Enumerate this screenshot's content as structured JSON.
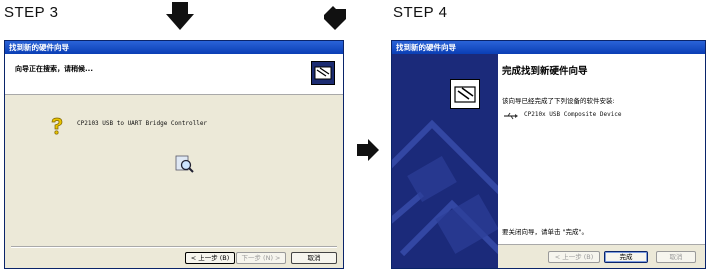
{
  "steps": {
    "step3_label": "STEP 3",
    "step4_label": "STEP 4"
  },
  "dialog1": {
    "title": "找到新的硬件向导",
    "header_text": "向导正在搜索，请稍候...",
    "device_name": "CP2103 USB to UART Bridge Controller",
    "buttons": {
      "back": "< 上一步 (B)",
      "next": "下一步 (N) >",
      "cancel": "取消"
    }
  },
  "dialog2": {
    "title": "找到新的硬件向导",
    "heading": "完成找到新硬件向导",
    "installed_text": "该向导已经完成了下列设备的软件安装:",
    "device_name": "CP210x USB Composite Device",
    "close_instruction": "要关闭向导，请单击 \"完成\"。",
    "buttons": {
      "back": "< 上一步 (B)",
      "finish": "完成",
      "cancel": "取消"
    }
  },
  "colors": {
    "titlebar": "#0a3eb5",
    "dialog_bg": "#ece9d8",
    "wizard_panel": "#1b2a7a"
  },
  "icons": [
    "down-arrow-icon",
    "diagonal-arrow-icon",
    "right-arrow-icon",
    "hardware-wizard-icon",
    "question-mark-icon",
    "search-magnifier-icon",
    "usb-icon"
  ]
}
